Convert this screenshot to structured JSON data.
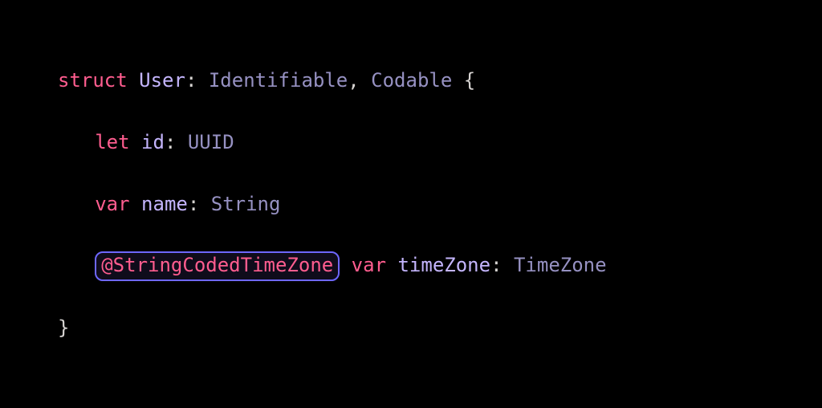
{
  "code": {
    "line1": {
      "kw_struct": "struct",
      "struct_name": "User",
      "colon1": ":",
      "protocol1": "Identifiable",
      "comma": ",",
      "protocol2": "Codable",
      "brace_open": "{"
    },
    "line2": {
      "kw_let": "let",
      "prop_id": "id",
      "colon": ":",
      "type_uuid": "UUID"
    },
    "line3": {
      "kw_var": "var",
      "prop_name": "name",
      "colon": ":",
      "type_string": "String"
    },
    "line4": {
      "attribute": "@StringCodedTimeZone",
      "kw_var": "var",
      "prop_timezone": "timeZone",
      "colon": ":",
      "type_timezone": "TimeZone"
    },
    "line5": {
      "brace_close": "}"
    }
  }
}
